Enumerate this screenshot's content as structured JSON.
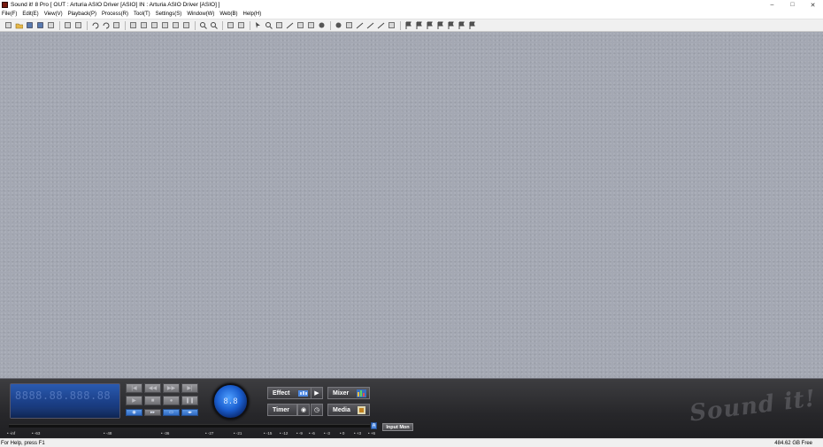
{
  "window": {
    "title": "Sound it! 8 Pro  [ OUT : Arturia ASIO Driver [ASIO]  IN : Arturia ASIO Driver [ASIO] ]",
    "controls": [
      "–",
      "□",
      "✕"
    ]
  },
  "menu": {
    "items": [
      "File(F)",
      "Edit(E)",
      "View(V)",
      "Playback(P)",
      "Process(R)",
      "Tool(T)",
      "Settings(S)",
      "Window(W)",
      "Web(B)",
      "Help(H)"
    ]
  },
  "toolbar": {
    "groups": [
      [
        "new-file-icon",
        "open-folder-icon",
        "save-icon",
        "save-all-icon",
        "open-recent-icon"
      ],
      [
        "properties-icon",
        "document-icon"
      ],
      [
        "undo-icon",
        "redo-icon",
        "clear-icon"
      ],
      [
        "cut-icon",
        "copy-icon",
        "paste-icon",
        "mix-paste-icon",
        "trim-icon",
        "erase-icon"
      ],
      [
        "zoom-wave-icon",
        "zoom-spectrum-icon"
      ],
      [
        "markers-icon",
        "regions-icon"
      ],
      [
        "cursor-icon",
        "zoom-tool-icon",
        "hand-tool-icon",
        "line-tool-icon",
        "pencil-tool-icon",
        "eraser-tool-icon",
        "record-tool-icon"
      ],
      [
        "loop-icon",
        "grid-icon",
        "fade-in-icon",
        "fade-out-icon",
        "crossfade-icon",
        "list-icon"
      ],
      [
        "flag-icon",
        "flag-alt-icon",
        "flag-grid-icon",
        "flag-left-icon",
        "flag-right-icon",
        "flag-all-icon",
        "flag-box-icon"
      ]
    ]
  },
  "transport": {
    "lcd_time": "8888.88.888.88",
    "knob_text": "8.8",
    "buttons": {
      "effect": "Effect",
      "mixer": "Mixer",
      "timer": "Timer",
      "media": "Media"
    },
    "input_monitor_label": "Input Mon",
    "meter_indicator": "A",
    "logo_text": "Sound it!",
    "meter_scale": [
      "-inf",
      "-63",
      "-48",
      "-36",
      "-27",
      "-21",
      "-15",
      "-12",
      "-9",
      "-6",
      "-3",
      "0",
      "+3",
      "+6"
    ]
  },
  "status": {
    "left": "For Help, press F1",
    "right": "484.62 GB Free"
  },
  "colors": {
    "workspace": "#a4a8b3",
    "transport_bg": "#2f2f32",
    "lcd_blue": "#1b3f86",
    "accent_blue": "#4d88e0"
  }
}
